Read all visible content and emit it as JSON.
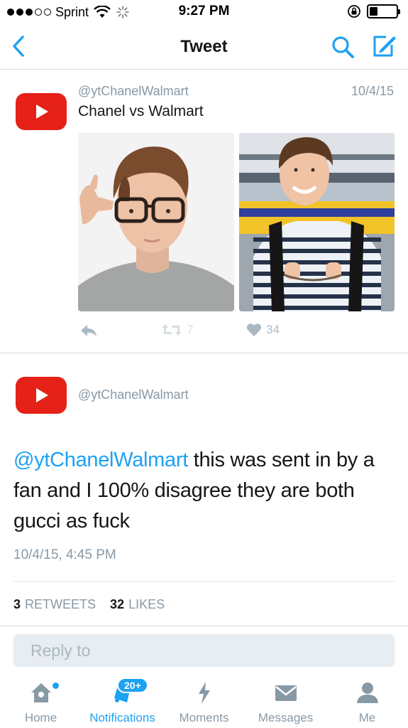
{
  "status_bar": {
    "carrier": "Sprint",
    "time": "9:27 PM",
    "battery_level": 0.3
  },
  "nav": {
    "title": "Tweet",
    "back_icon": "chevron-left-icon",
    "search_icon": "search-icon",
    "compose_icon": "compose-icon"
  },
  "tweet": {
    "handle": "@ytChanelWalmart",
    "date": "10/4/15",
    "text": "Chanel vs Walmart",
    "retweet_count": "7",
    "like_count": "34"
  },
  "reply_tweet": {
    "handle": "@ytChanelWalmart",
    "mention": "@ytChanelWalmart",
    "text": " this was sent in by a fan and I 100% disagree they are both gucci as fuck",
    "timestamp": "10/4/15, 4:45 PM",
    "retweets_count": "3",
    "retweets_label": "RETWEETS",
    "likes_count": "32",
    "likes_label": "LIKES"
  },
  "reply_box": {
    "placeholder": "Reply to"
  },
  "tab_bar": {
    "tabs": [
      {
        "label": "Home",
        "icon": "home-icon"
      },
      {
        "label": "Notifications",
        "icon": "bell-icon",
        "badge": "20+"
      },
      {
        "label": "Moments",
        "icon": "lightning-icon"
      },
      {
        "label": "Messages",
        "icon": "envelope-icon"
      },
      {
        "label": "Me",
        "icon": "person-icon"
      }
    ],
    "active": "Notifications"
  },
  "colors": {
    "accent": "#1da1f2",
    "youtube_red": "#e62117",
    "secondary_text": "#8899a6"
  }
}
